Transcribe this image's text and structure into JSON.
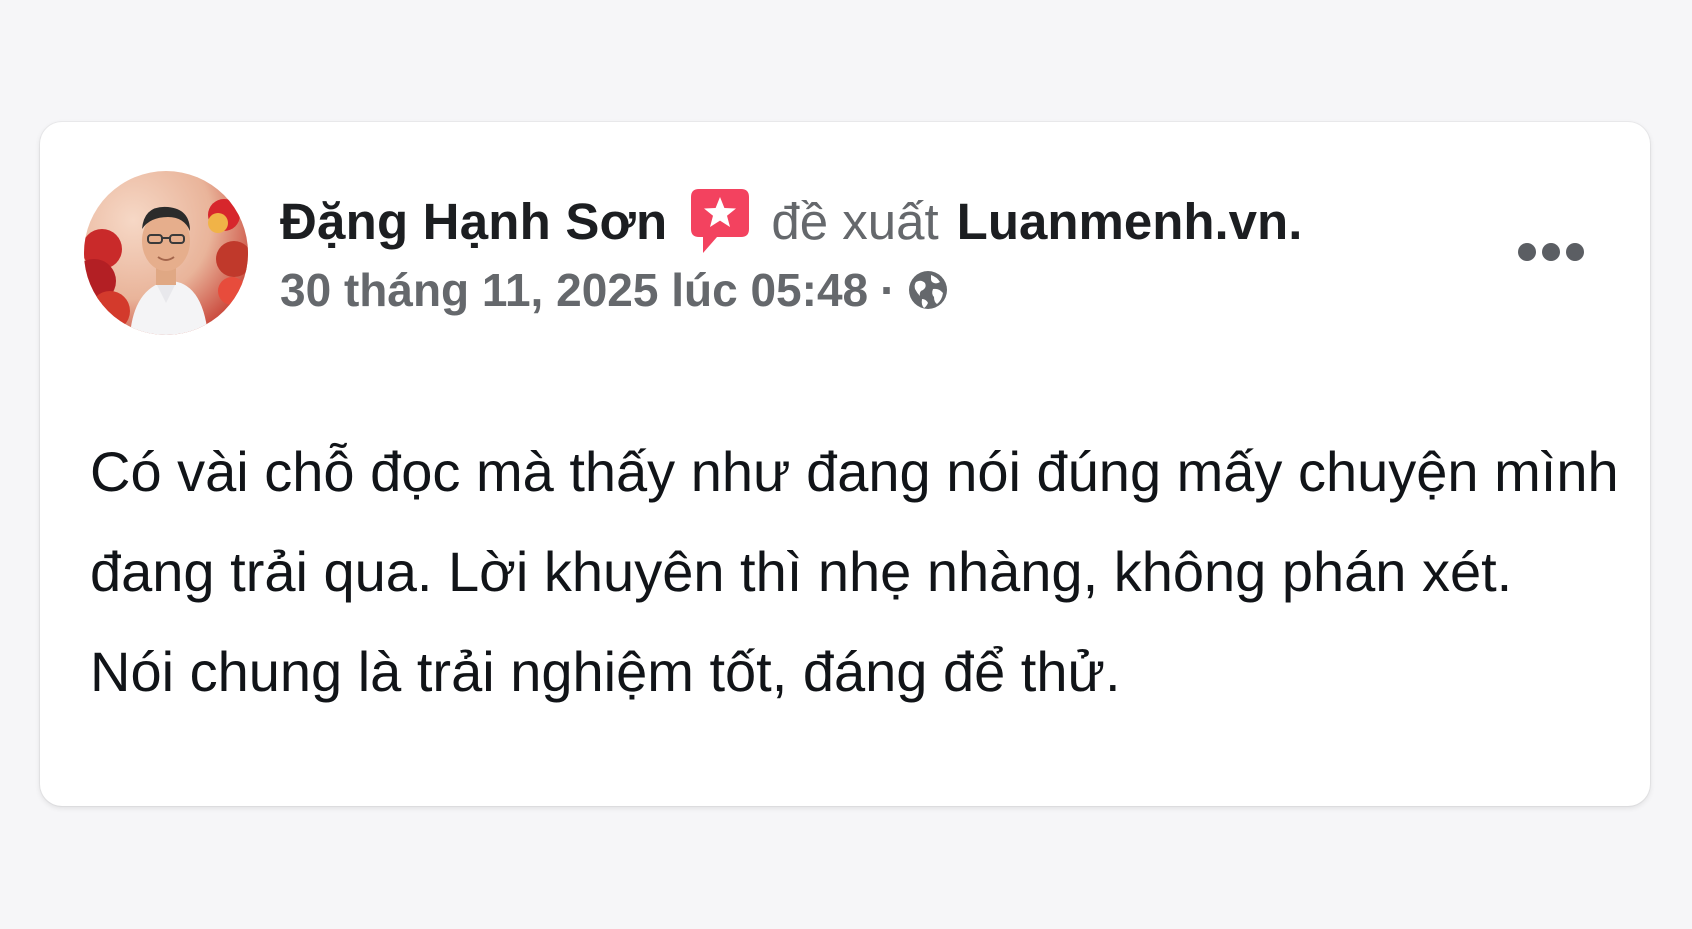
{
  "post": {
    "author": {
      "name": "Đặng Hạnh Sơn",
      "avatar_icon": "profile-photo"
    },
    "recommend": {
      "icon": "recommendation-star-icon",
      "icon_color": "#f3425f",
      "verb": "đề xuất",
      "page": "Luanmenh.vn."
    },
    "meta": {
      "timestamp": "30 tháng 11, 2025 lúc 05:48",
      "separator": "·",
      "audience_icon": "globe-icon"
    },
    "more_icon": "more-options-icon",
    "body_lines": [
      "Có vài chỗ đọc mà thấy như đang nói đúng mấy chuyện mình",
      "đang trải qua. Lời khuyên thì nhẹ nhàng, không phán xét.",
      "Nói chung là trải nghiệm tốt, đáng để thử."
    ]
  }
}
